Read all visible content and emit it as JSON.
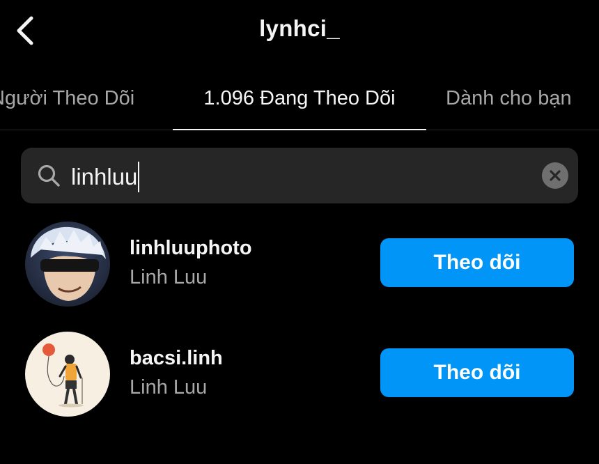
{
  "header": {
    "title": "lynhci_",
    "back_icon": "chevron-left-icon"
  },
  "tabs": [
    {
      "label": "Người Theo Dõi",
      "active": false
    },
    {
      "label": "1.096 Đang Theo Dõi",
      "active": true
    },
    {
      "label": "Dành cho bạn",
      "active": false
    }
  ],
  "search": {
    "value": "linhluu",
    "icon": "search-icon",
    "clear_icon": "close-circle-icon"
  },
  "results": [
    {
      "username": "linhluuphoto",
      "full_name": "Linh Luu",
      "button_label": "Theo dõi",
      "avatar": "anime-character-avatar"
    },
    {
      "username": "bacsi.linh",
      "full_name": "Linh Luu",
      "button_label": "Theo dõi",
      "avatar": "illustration-balloon-avatar"
    }
  ],
  "colors": {
    "background": "#000000",
    "search_bg": "#262626",
    "primary_button": "#0095f6",
    "secondary_text": "#a8a8a8"
  }
}
